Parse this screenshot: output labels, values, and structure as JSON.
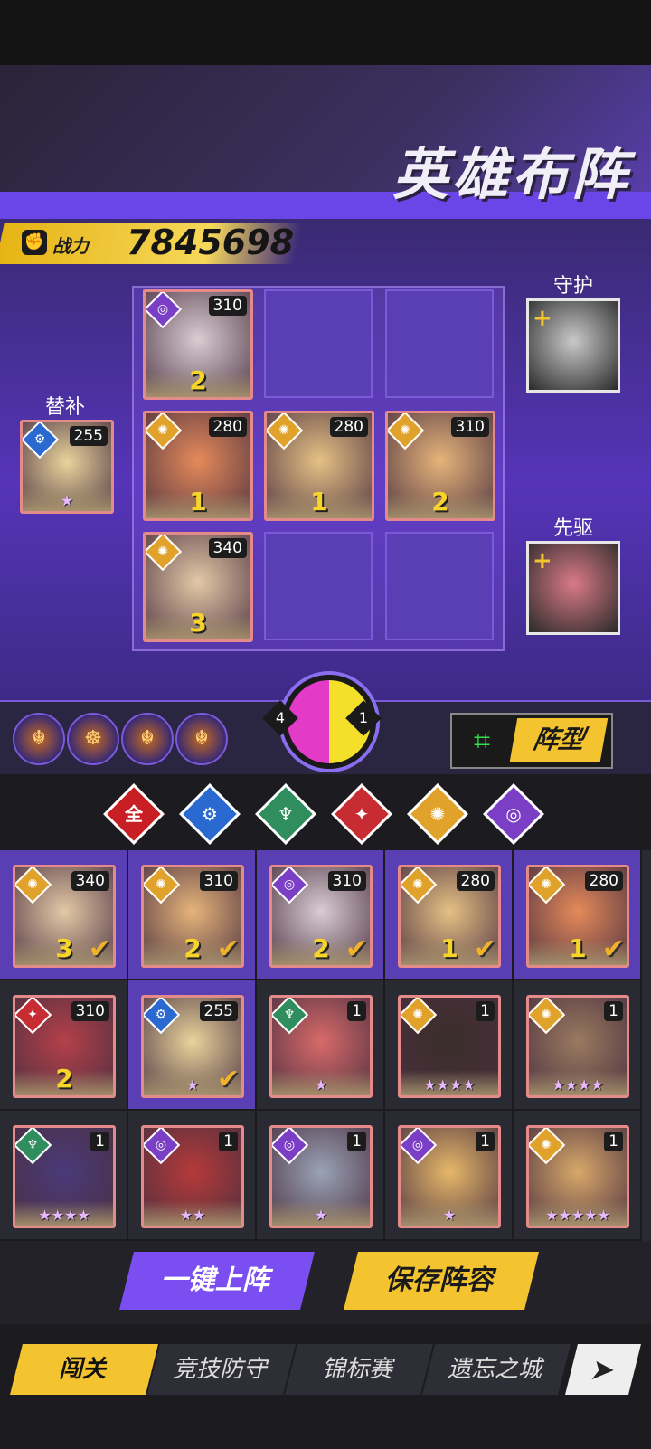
{
  "header": {
    "title": "英雄布阵"
  },
  "power": {
    "label": "战力",
    "value": "7845698"
  },
  "side": {
    "sub_label": "替补",
    "guard_label": "守护",
    "vanguard_label": "先驱"
  },
  "lineup": [
    {
      "level": "310",
      "stars": "2",
      "element": "◎",
      "elem_color": "#7a3fc4",
      "face": "#d9cdd2"
    },
    {
      "level": "280",
      "stars": "1",
      "element": "✺",
      "elem_color": "#e0a22a",
      "face": "#e58a5a"
    },
    {
      "level": "280",
      "stars": "1",
      "element": "✺",
      "elem_color": "#e0a22a",
      "face": "#e6c184"
    },
    {
      "level": "310",
      "stars": "2",
      "element": "✺",
      "elem_color": "#e0a22a",
      "face": "#e6b47a"
    },
    {
      "level": "340",
      "stars": "3",
      "element": "✺",
      "elem_color": "#e0a22a",
      "face": "#e3c9a6"
    }
  ],
  "substitute": {
    "level": "255",
    "stars": "★",
    "element": "⚙",
    "elem_color": "#2a6ad0",
    "face": "#e8d49c"
  },
  "guard": {
    "plus": "+",
    "face": "#c9c9c9"
  },
  "vanguard": {
    "plus": "+",
    "face": "#d97a86"
  },
  "wheel": {
    "left": "4",
    "right": "1"
  },
  "skills": [
    "☬",
    "☸",
    "☬",
    "☬"
  ],
  "formation": {
    "label": "阵型",
    "icon": "⌗"
  },
  "filters": [
    {
      "label": "全",
      "color": "#c81f24"
    },
    {
      "label": "⚙",
      "color": "#2a6ad0"
    },
    {
      "label": "♆",
      "color": "#2f8d5e"
    },
    {
      "label": "✦",
      "color": "#c62c32"
    },
    {
      "label": "✺",
      "color": "#e0a22a"
    },
    {
      "label": "◎",
      "color": "#7a3fc4"
    }
  ],
  "roster": [
    {
      "level": "340",
      "rank": "3",
      "element": "✺",
      "elem_color": "#e0a22a",
      "face": "#e3c9a6",
      "check": "✔",
      "selected": true
    },
    {
      "level": "310",
      "rank": "2",
      "element": "✺",
      "elem_color": "#e0a22a",
      "face": "#e6b47a",
      "check": "✔",
      "selected": true
    },
    {
      "level": "310",
      "rank": "2",
      "element": "◎",
      "elem_color": "#7a3fc4",
      "face": "#d9cdd2",
      "check": "✔",
      "selected": true
    },
    {
      "level": "280",
      "rank": "1",
      "element": "✺",
      "elem_color": "#e0a22a",
      "face": "#e6c184",
      "check": "✔",
      "selected": true
    },
    {
      "level": "280",
      "rank": "1",
      "element": "✺",
      "elem_color": "#e0a22a",
      "face": "#e58a5a",
      "check": "✔",
      "selected": true
    },
    {
      "level": "310",
      "rank": "2",
      "element": "✦",
      "elem_color": "#c62c32",
      "face": "#b4404a",
      "check": "",
      "selected": false
    },
    {
      "level": "255",
      "rank": "★",
      "element": "⚙",
      "elem_color": "#2a6ad0",
      "face": "#e8d49c",
      "check": "✔",
      "selected": true
    },
    {
      "level": "1",
      "rank": "★",
      "element": "♆",
      "elem_color": "#2f8d5e",
      "face": "#d86a6a",
      "check": "",
      "selected": false
    },
    {
      "level": "1",
      "rank": "★★★★",
      "element": "✺",
      "elem_color": "#e0a22a",
      "face": "#3a2e2a",
      "check": "",
      "selected": false
    },
    {
      "level": "1",
      "rank": "★★★★",
      "element": "✺",
      "elem_color": "#e0a22a",
      "face": "#9a7a60",
      "check": "",
      "selected": false
    },
    {
      "level": "1",
      "rank": "★★★★",
      "element": "♆",
      "elem_color": "#2f8d5e",
      "face": "#4a3a7a",
      "check": "",
      "selected": false
    },
    {
      "level": "1",
      "rank": "★★",
      "element": "◎",
      "elem_color": "#7a3fc4",
      "face": "#b53a3a",
      "check": "",
      "selected": false
    },
    {
      "level": "1",
      "rank": "★",
      "element": "◎",
      "elem_color": "#7a3fc4",
      "face": "#9aa2b6",
      "check": "",
      "selected": false
    },
    {
      "level": "1",
      "rank": "★",
      "element": "◎",
      "elem_color": "#7a3fc4",
      "face": "#e6b86a",
      "check": "",
      "selected": false
    },
    {
      "level": "1",
      "rank": "★★★★★",
      "element": "✺",
      "elem_color": "#e0a22a",
      "face": "#d8a86a",
      "check": "",
      "selected": false
    }
  ],
  "actions": {
    "auto_deploy": "一键上阵",
    "save": "保存阵容"
  },
  "tabs": [
    {
      "label": "闯关",
      "active": true
    },
    {
      "label": "竞技防守",
      "active": false
    },
    {
      "label": "锦标赛",
      "active": false
    },
    {
      "label": "遗忘之城",
      "active": false
    }
  ],
  "next_icon": "➤"
}
